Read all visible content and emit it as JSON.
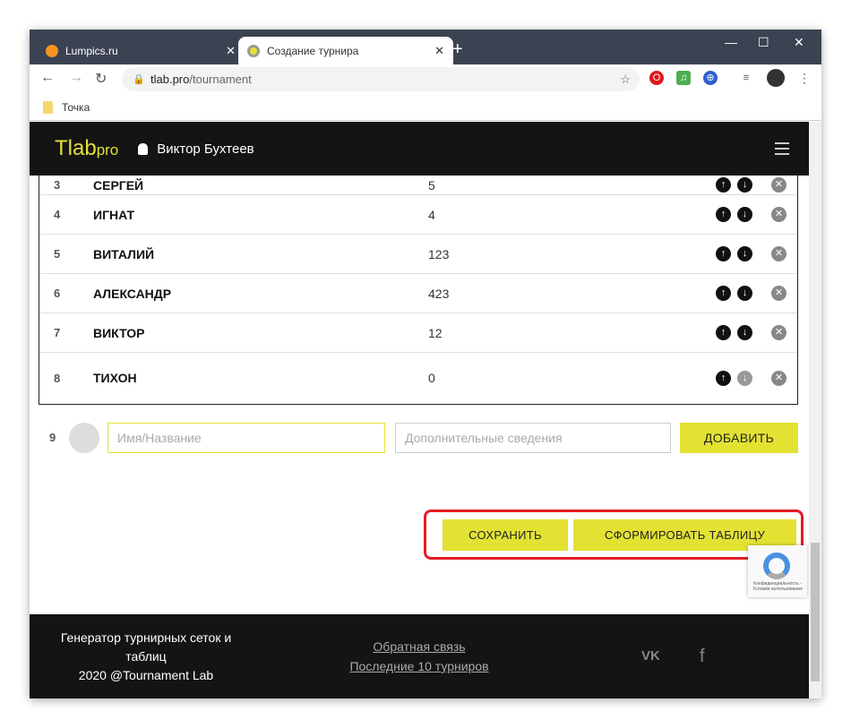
{
  "browser": {
    "tabs": [
      {
        "title": "Lumpics.ru",
        "active": false
      },
      {
        "title": "Создание турнира",
        "active": true
      }
    ],
    "url_host": "tlab.pro",
    "url_path": "/tournament",
    "bookmark": "Точка"
  },
  "header": {
    "logo_main": "Tlab",
    "logo_sub": "pro",
    "user": "Виктор Бухтеев"
  },
  "table": {
    "rows": [
      {
        "num": "3",
        "name": "СЕРГЕЙ",
        "value": "5"
      },
      {
        "num": "4",
        "name": "ИГНАТ",
        "value": "4"
      },
      {
        "num": "5",
        "name": "ВИТАЛИЙ",
        "value": "123"
      },
      {
        "num": "6",
        "name": "АЛЕКСАНДР",
        "value": "423"
      },
      {
        "num": "7",
        "name": "ВИКТОР",
        "value": "12"
      },
      {
        "num": "8",
        "name": "ТИХОН",
        "value": "0"
      }
    ]
  },
  "add": {
    "num": "9",
    "name_placeholder": "Имя/Название",
    "info_placeholder": "Дополнительные сведения",
    "button": "ДОБАВИТЬ"
  },
  "actions": {
    "save": "СОХРАНИТЬ",
    "generate": "СФОРМИРОВАТЬ ТАБЛИЦУ"
  },
  "footer": {
    "line1": "Генератор турнирных сеток и таблиц",
    "line2": "2020 @Tournament Lab",
    "feedback": "Обратная связь",
    "last10": "Последние 10 турниров",
    "vk": "VK",
    "fb": "f",
    "captcha": "Конфиденциальность - Условия использования"
  },
  "colors": {
    "accent": "#e3e233",
    "highlight": "#e31e24"
  }
}
